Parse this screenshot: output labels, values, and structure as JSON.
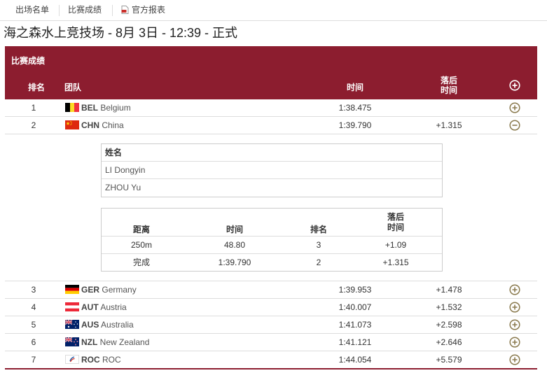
{
  "tabs": [
    {
      "label": "出场名单"
    },
    {
      "label": "比赛成绩"
    },
    {
      "label": "官方报表"
    }
  ],
  "page_title": "海之森水上竞技场 - 8月 3日 - 12:39 - 正式",
  "panel": {
    "title": "比赛成绩",
    "headers": {
      "rank": "排名",
      "team": "团队",
      "time": "时间",
      "behind_line1": "落后",
      "behind_line2": "时间"
    }
  },
  "results": [
    {
      "rank": "1",
      "code": "BEL",
      "name": "Belgium",
      "time": "1:38.475",
      "behind": "",
      "flag": "bel-flag-icon",
      "expanded": false
    },
    {
      "rank": "2",
      "code": "CHN",
      "name": "China",
      "time": "1:39.790",
      "behind": "+1.315",
      "flag": "chn-flag-icon",
      "expanded": true
    },
    {
      "rank": "3",
      "code": "GER",
      "name": "Germany",
      "time": "1:39.953",
      "behind": "+1.478",
      "flag": "ger-flag-icon",
      "expanded": false
    },
    {
      "rank": "4",
      "code": "AUT",
      "name": "Austria",
      "time": "1:40.007",
      "behind": "+1.532",
      "flag": "aut-flag-icon",
      "expanded": false
    },
    {
      "rank": "5",
      "code": "AUS",
      "name": "Australia",
      "time": "1:41.073",
      "behind": "+2.598",
      "flag": "aus-flag-icon",
      "expanded": false
    },
    {
      "rank": "6",
      "code": "NZL",
      "name": "New Zealand",
      "time": "1:41.121",
      "behind": "+2.646",
      "flag": "nzl-flag-icon",
      "expanded": false
    },
    {
      "rank": "7",
      "code": "ROC",
      "name": "ROC",
      "time": "1:44.054",
      "behind": "+5.579",
      "flag": "roc-flag-icon",
      "expanded": false
    }
  ],
  "details": {
    "members_header": "姓名",
    "members": [
      "LI Dongyin",
      "ZHOU Yu"
    ],
    "splits_headers": {
      "distance": "距离",
      "time": "时间",
      "rank": "排名",
      "behind_line1": "落后",
      "behind_line2": "时间"
    },
    "splits": [
      {
        "distance": "250m",
        "time": "48.80",
        "rank": "3",
        "behind": "+1.09"
      },
      {
        "distance": "完成",
        "time": "1:39.790",
        "rank": "2",
        "behind": "+1.315"
      }
    ]
  },
  "colors": {
    "header_bg": "#8c1d2f",
    "toggle_icon": "#8a7a4e",
    "border": "#dddddd"
  },
  "icons": {
    "expand_all": "plus-circle-icon",
    "expand_row": "plus-circle-icon",
    "collapse_row": "minus-circle-icon",
    "report": "pdf-icon"
  }
}
